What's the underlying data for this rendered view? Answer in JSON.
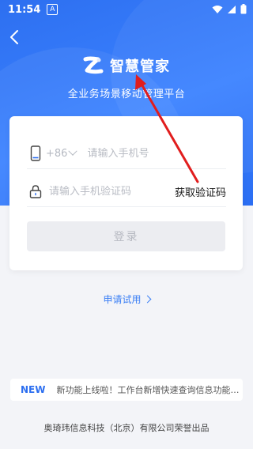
{
  "status_bar": {
    "time": "11:54",
    "notification": "A"
  },
  "header": {
    "app_name": "智慧管家",
    "subtitle": "全业务场景移动管理平台"
  },
  "login_form": {
    "country_code": "+86",
    "phone_placeholder": "请输入手机号",
    "code_placeholder": "请输入手机验证码",
    "get_code_label": "获取验证码",
    "login_label": "登录"
  },
  "apply_trial_label": "申请试用",
  "notice": {
    "badge": "NEW",
    "text": "新功能上线啦！工作台新增快速查询信息功能，可..."
  },
  "footer": "奥琦玮信息科技（北京）有限公司荣誉出品",
  "colors": {
    "primary": "#2d6ff0",
    "annotation": "#e11d1d"
  }
}
